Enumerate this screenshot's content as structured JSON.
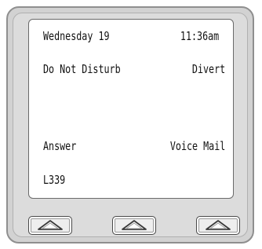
{
  "display": {
    "date": "Wednesday 19",
    "time": "11:36am",
    "feature_left": "Do Not Disturb",
    "feature_right": "Divert",
    "softkey_left": "Answer",
    "softkey_right": "Voice Mail",
    "line": "L339"
  },
  "softkeys": [
    {
      "icon": "chevron-up-icon"
    },
    {
      "icon": "chevron-up-icon"
    },
    {
      "icon": "chevron-up-icon"
    }
  ],
  "colors": {
    "bezel": "#d2d2d2",
    "screen": "#ffffff",
    "text": "#111111"
  }
}
